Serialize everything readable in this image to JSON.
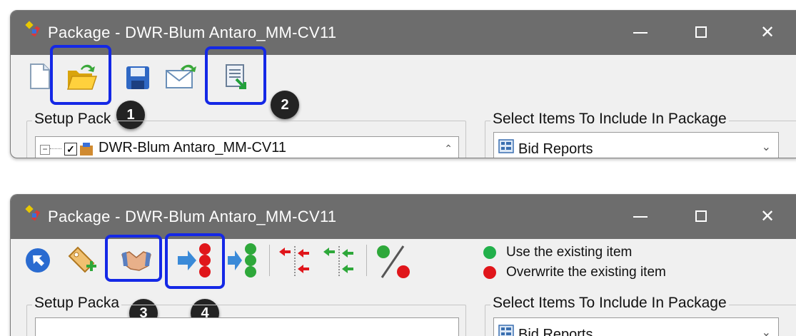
{
  "window1": {
    "title": "Package - DWR-Blum Antaro_MM-CV11",
    "toolbar": {
      "new": "new-document-icon",
      "open": "open-folder-icon",
      "save": "save-icon",
      "email": "email-send-icon",
      "export": "export-document-icon"
    },
    "callouts": [
      "1",
      "2"
    ],
    "setup_label": "Setup Pack",
    "tree_item": "DWR-Blum Antaro_MM-CV11",
    "select_label": "Select Items To Include In Package",
    "select_value": "Bid Reports"
  },
  "window2": {
    "title": "Package - DWR-Blum Antaro_MM-CV11",
    "toolbar": {
      "back": "back-arrow-icon",
      "add_tag": "add-tag-icon",
      "handshake": "handshake-icon",
      "arrow_red": "arrow-red-lights-icon",
      "arrow_green": "arrow-green-lights-icon",
      "tree_red": "tree-red-icon",
      "tree_green": "tree-green-icon",
      "percent": "percent-icon"
    },
    "callouts": [
      "3",
      "4"
    ],
    "legend": [
      {
        "text": "Use the existing item",
        "color": "#22b04b"
      },
      {
        "text": "Overwrite the existing item",
        "color": "#e0161b"
      }
    ],
    "setup_label": "Setup Packa",
    "select_label": "Select Items To Include In Package",
    "select_value": "Bid Reports"
  },
  "colors": {
    "titlebar": "#6d6d6d",
    "highlight": "#1428e6",
    "callout": "#232323"
  }
}
